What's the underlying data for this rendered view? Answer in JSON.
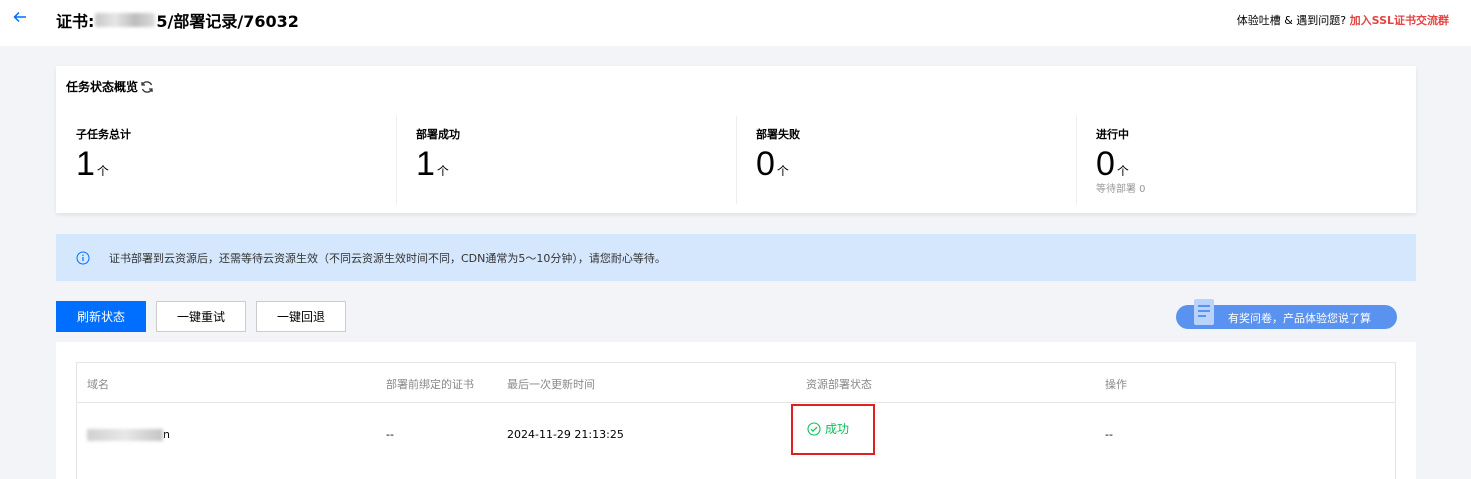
{
  "header": {
    "title_prefix": "证书: ",
    "title_suffix": "5/部署记录/76032",
    "feedback_text": "体验吐槽 & 遇到问题? ",
    "feedback_link": "加入SSL证书交流群"
  },
  "overview": {
    "title": "任务状态概览",
    "stats": [
      {
        "label": "子任务总计",
        "value": "1",
        "unit": "个"
      },
      {
        "label": "部署成功",
        "value": "1",
        "unit": "个"
      },
      {
        "label": "部署失败",
        "value": "0",
        "unit": "个"
      },
      {
        "label": "进行中",
        "value": "0",
        "unit": "个",
        "sub": "等待部署 0"
      }
    ]
  },
  "notice": {
    "text": "证书部署到云资源后，还需等待云资源生效（不同云资源生效时间不同，CDN通常为5～10分钟），请您耐心等待。"
  },
  "actions": {
    "refresh": "刷新状态",
    "retry": "一键重试",
    "rollback": "一键回退",
    "survey": "有奖问卷，产品体验您说了算"
  },
  "table": {
    "columns": [
      "域名",
      "部署前绑定的证书",
      "最后一次更新时间",
      "资源部署状态",
      "操作"
    ],
    "rows": [
      {
        "domain_suffix": "n",
        "prev_cert": "--",
        "updated": "2024-11-29 21:13:25",
        "status": "成功",
        "op": "--"
      }
    ]
  },
  "colors": {
    "primary": "#006eff",
    "success": "#0abf5b",
    "highlight": "#e02020",
    "link": "#e54545",
    "notice_bg": "#d5e7fd"
  }
}
